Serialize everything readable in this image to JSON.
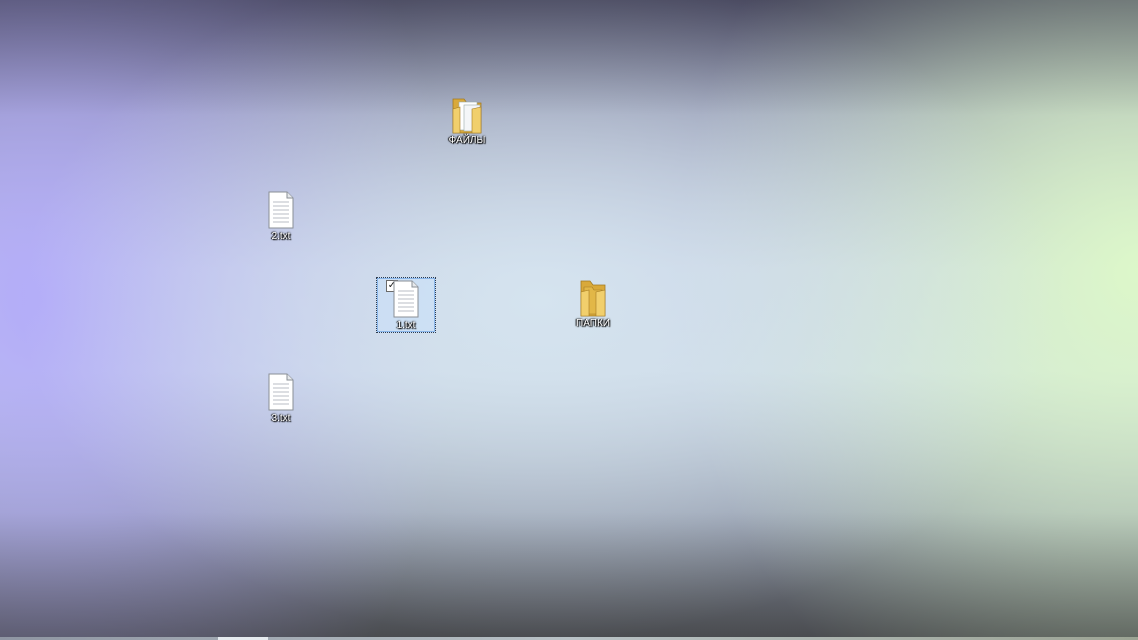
{
  "desktop": {
    "icons": [
      {
        "label": "ФАЙЛЫ",
        "type": "folder-icon"
      },
      {
        "label": "2.txt",
        "type": "text-file-icon"
      },
      {
        "label": "1.txt",
        "type": "text-file-icon",
        "selected": true,
        "checkbox": "✓"
      },
      {
        "label": "ПАПКИ",
        "type": "folder-icon"
      },
      {
        "label": "3.txt",
        "type": "text-file-icon"
      }
    ]
  },
  "colors": {
    "folder": "#e8c45a",
    "selection": "#c8e0fa",
    "label_text": "#ffffff"
  }
}
